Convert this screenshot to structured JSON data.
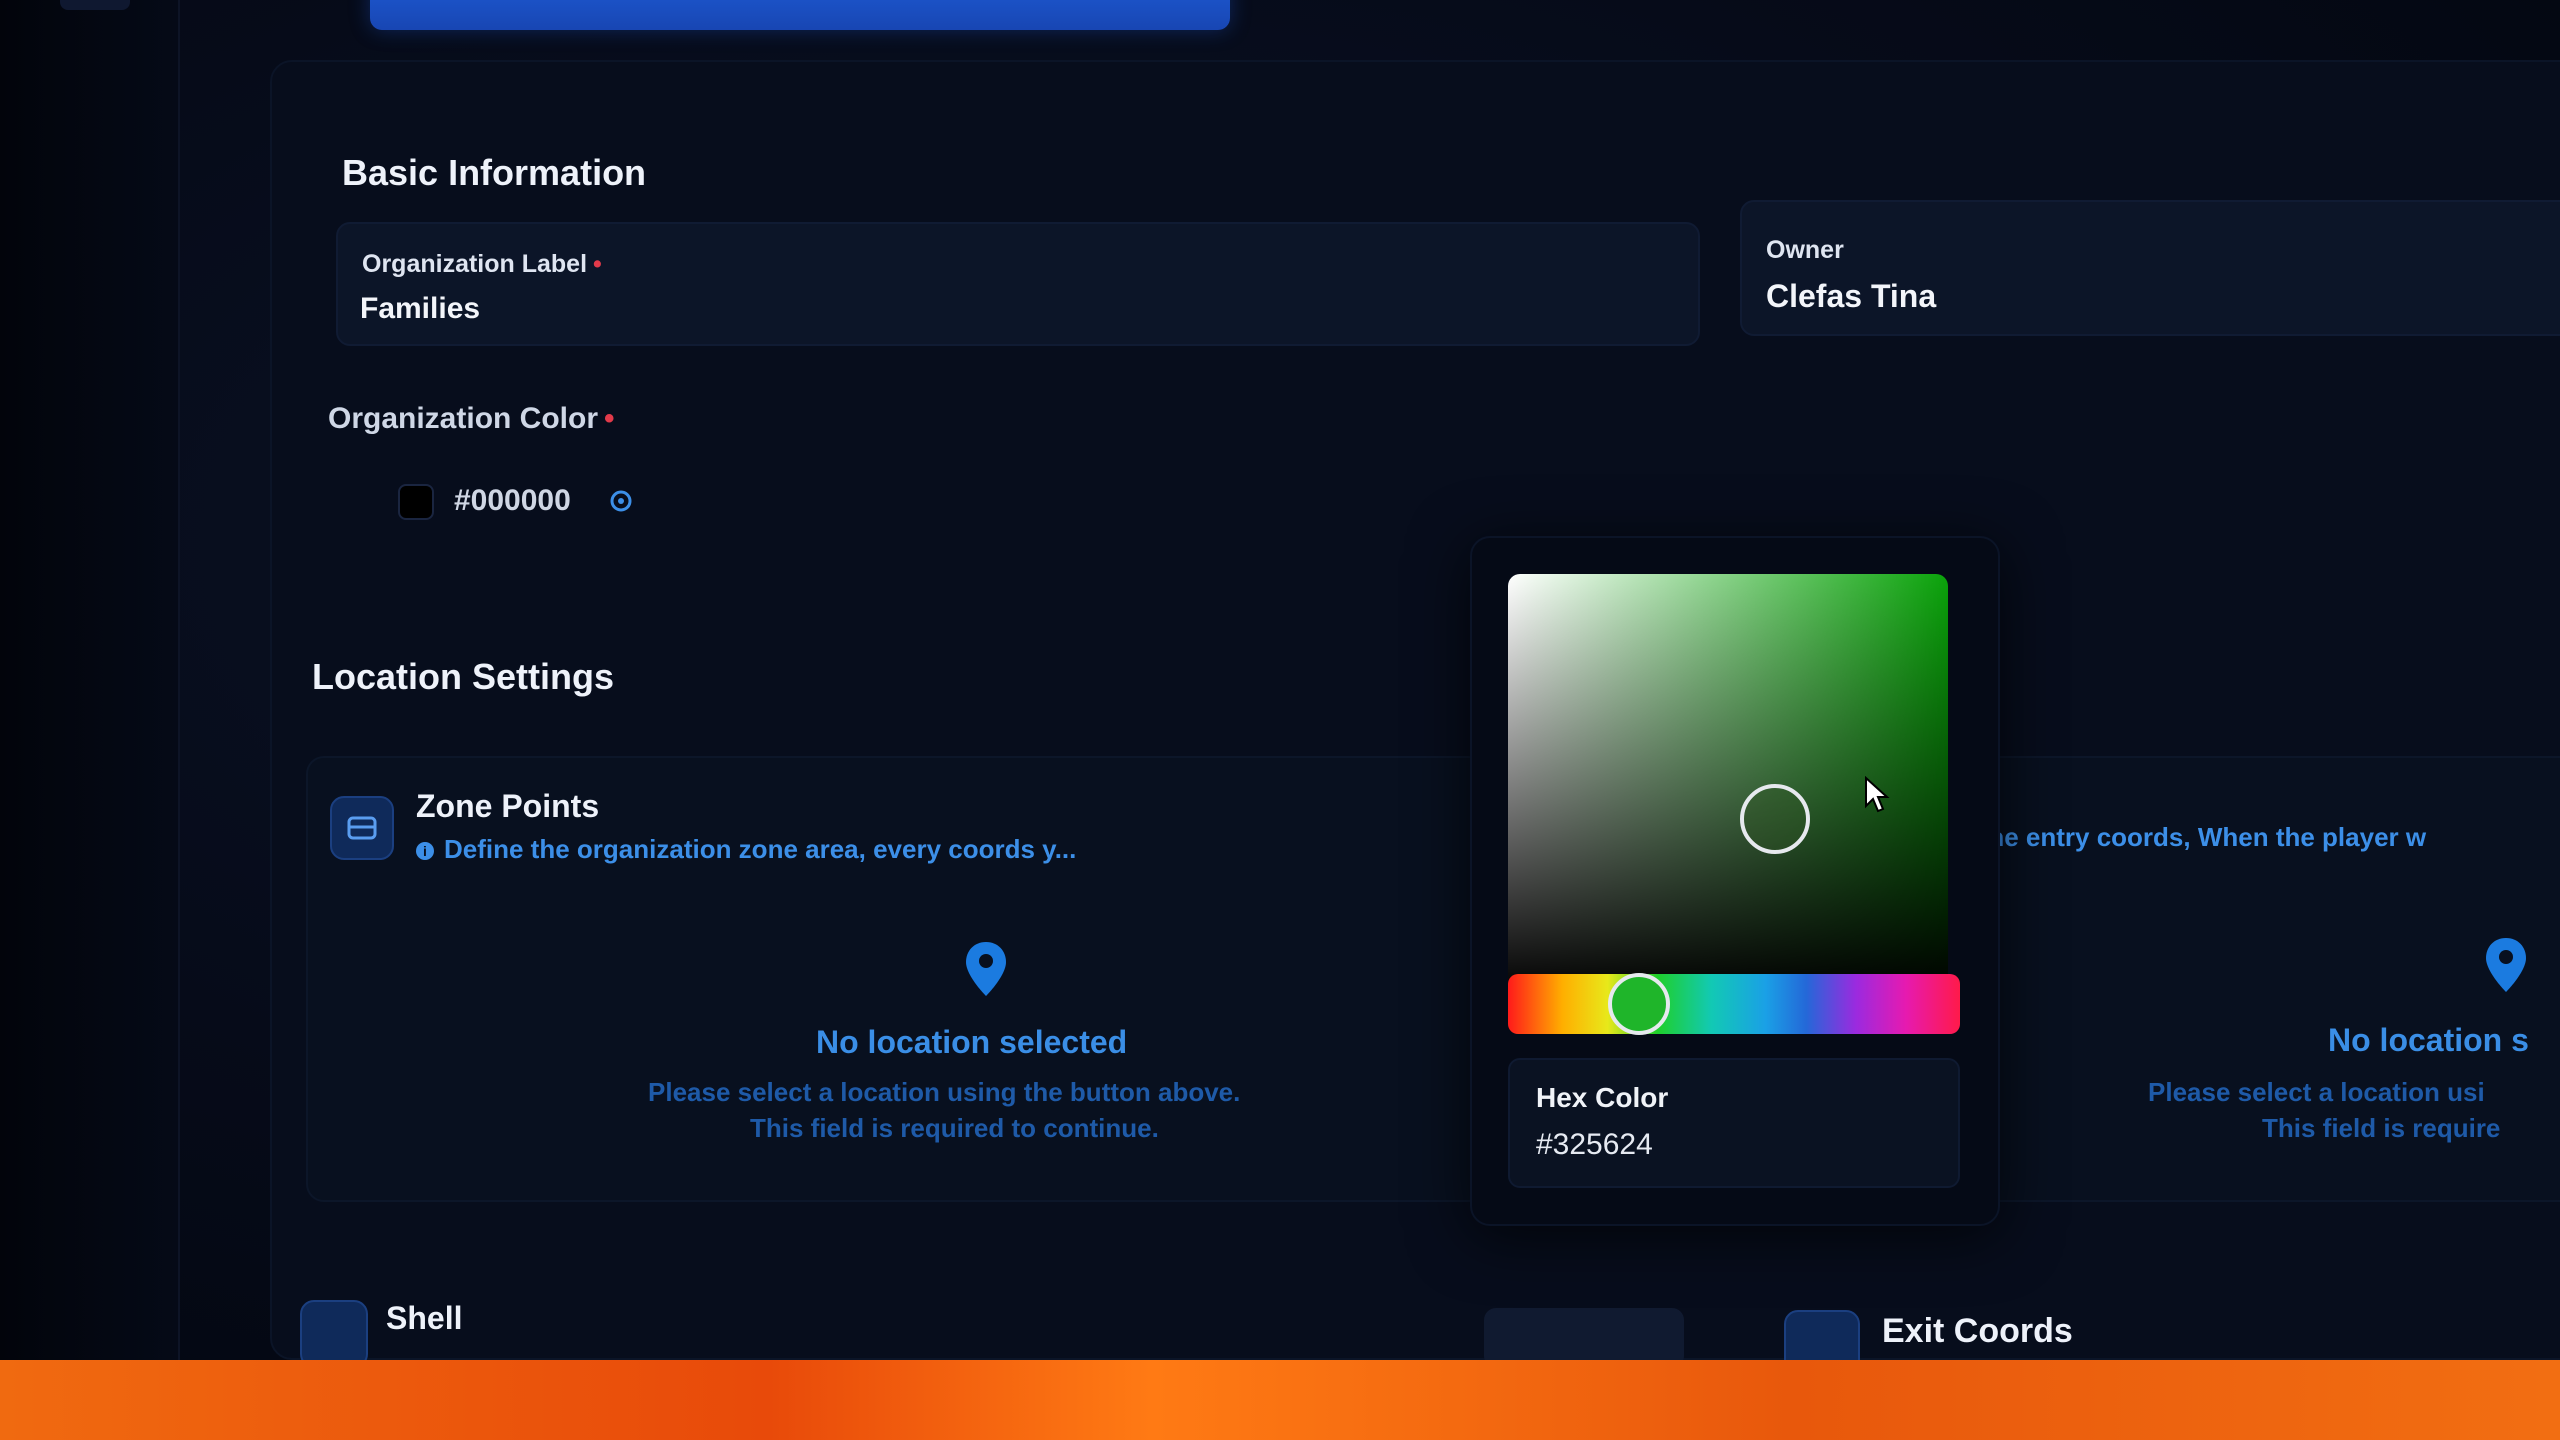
{
  "basic_info": {
    "section_title": "Basic Information",
    "org_label": {
      "label": "Organization Label",
      "value": "Families"
    },
    "owner": {
      "label": "Owner",
      "value": "Clefas Tina"
    },
    "org_color": {
      "label": "Organization Color",
      "value": "#000000"
    },
    "required_mark": "•"
  },
  "location": {
    "section_title": "Location Settings",
    "zone_points": {
      "title": "Zone Points",
      "description": "Define the organization zone area, every coords y...",
      "empty_title": "No location selected",
      "empty_line1": "Please select a location using the button above.",
      "empty_line2": "This field is required to continue."
    },
    "entry_coords": {
      "description": "e the entry coords, When the player w",
      "empty_title": "No location s",
      "empty_line1": "Please select a location usi",
      "empty_line2": "This field is require"
    },
    "shell": {
      "title": "Shell"
    },
    "exit_coords": {
      "title": "Exit Coords"
    }
  },
  "color_picker": {
    "hex_label": "Hex Color",
    "hex_value": "#325624",
    "hue_color": "#1fb52a",
    "hue_fraction": 0.29
  },
  "colors": {
    "accent_blue": "#3c8fe8",
    "required_red": "#e23a4a",
    "bottom_orange": "#f06a10"
  }
}
